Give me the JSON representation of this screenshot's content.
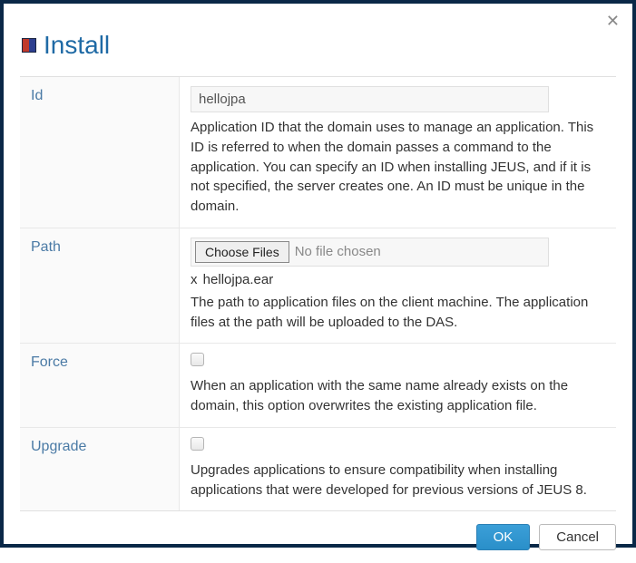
{
  "dialog": {
    "title": "Install",
    "close_aria": "Close"
  },
  "fields": {
    "id": {
      "label": "Id",
      "value": "hellojpa",
      "help": "Application ID that the domain uses to manage an application. This ID is referred to when the domain passes a command to the application. You can specify an ID when installing JEUS, and if it is not specified, the server creates one. An ID must be unique in the domain."
    },
    "path": {
      "label": "Path",
      "choose_button": "Choose Files",
      "file_status": "No file chosen",
      "chosen_prefix": "x",
      "chosen_filename": "hellojpa.ear",
      "help": "The path to application files on the client machine. The application files at the path will be uploaded to the DAS."
    },
    "force": {
      "label": "Force",
      "checked": false,
      "help": "When an application with the same name already exists on the domain, this option overwrites the existing application file."
    },
    "upgrade": {
      "label": "Upgrade",
      "checked": false,
      "help": "Upgrades applications to ensure compatibility when installing applications that were developed for previous versions of JEUS 8."
    }
  },
  "footer": {
    "ok": "OK",
    "cancel": "Cancel"
  }
}
